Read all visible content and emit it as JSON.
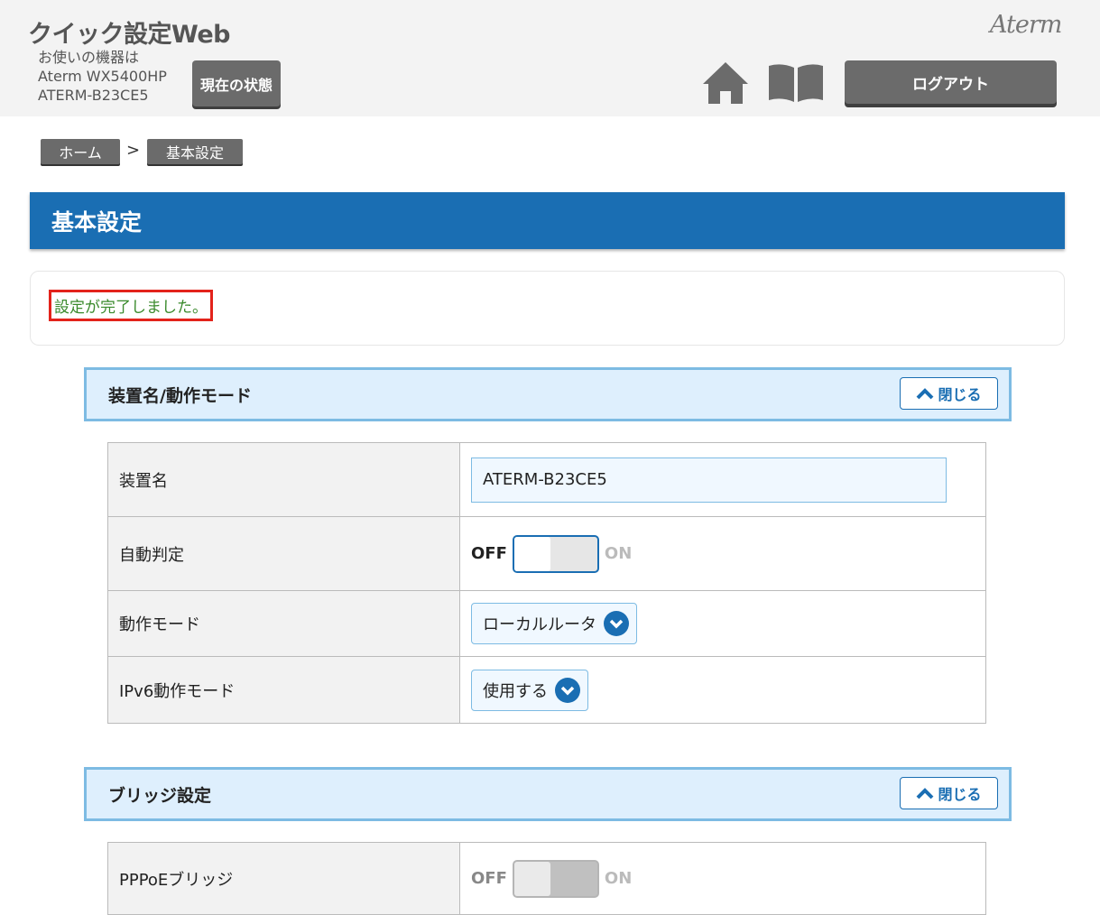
{
  "header": {
    "app_title": "クイック設定Web",
    "device_label": "お使いの機器は",
    "model": "Aterm WX5400HP",
    "device_id": "ATERM-B23CE5",
    "status_button": "現在の状態",
    "logo": "Aterm",
    "logout_button": "ログアウト"
  },
  "breadcrumb": {
    "home": "ホーム",
    "separator": ">",
    "current": "基本設定"
  },
  "page": {
    "title": "基本設定",
    "message": "設定が完了しました。"
  },
  "sections": [
    {
      "title": "装置名/動作モード",
      "close_label": "閉じる",
      "rows": [
        {
          "label": "装置名",
          "value": "ATERM-B23CE5"
        },
        {
          "label": "自動判定",
          "toggle_off": "OFF",
          "toggle_on": "ON",
          "state": "OFF"
        },
        {
          "label": "動作モード",
          "selected": "ローカルルータ"
        },
        {
          "label": "IPv6動作モード",
          "selected": "使用する"
        }
      ]
    },
    {
      "title": "ブリッジ設定",
      "close_label": "閉じる",
      "rows": [
        {
          "label": "PPPoEブリッジ",
          "toggle_off": "OFF",
          "toggle_on": "ON",
          "state": "OFF (disabled)"
        }
      ]
    }
  ],
  "colors": {
    "accent": "#1a6eb3",
    "success_text": "#3a8a2c",
    "highlight_border": "#e3231b"
  }
}
